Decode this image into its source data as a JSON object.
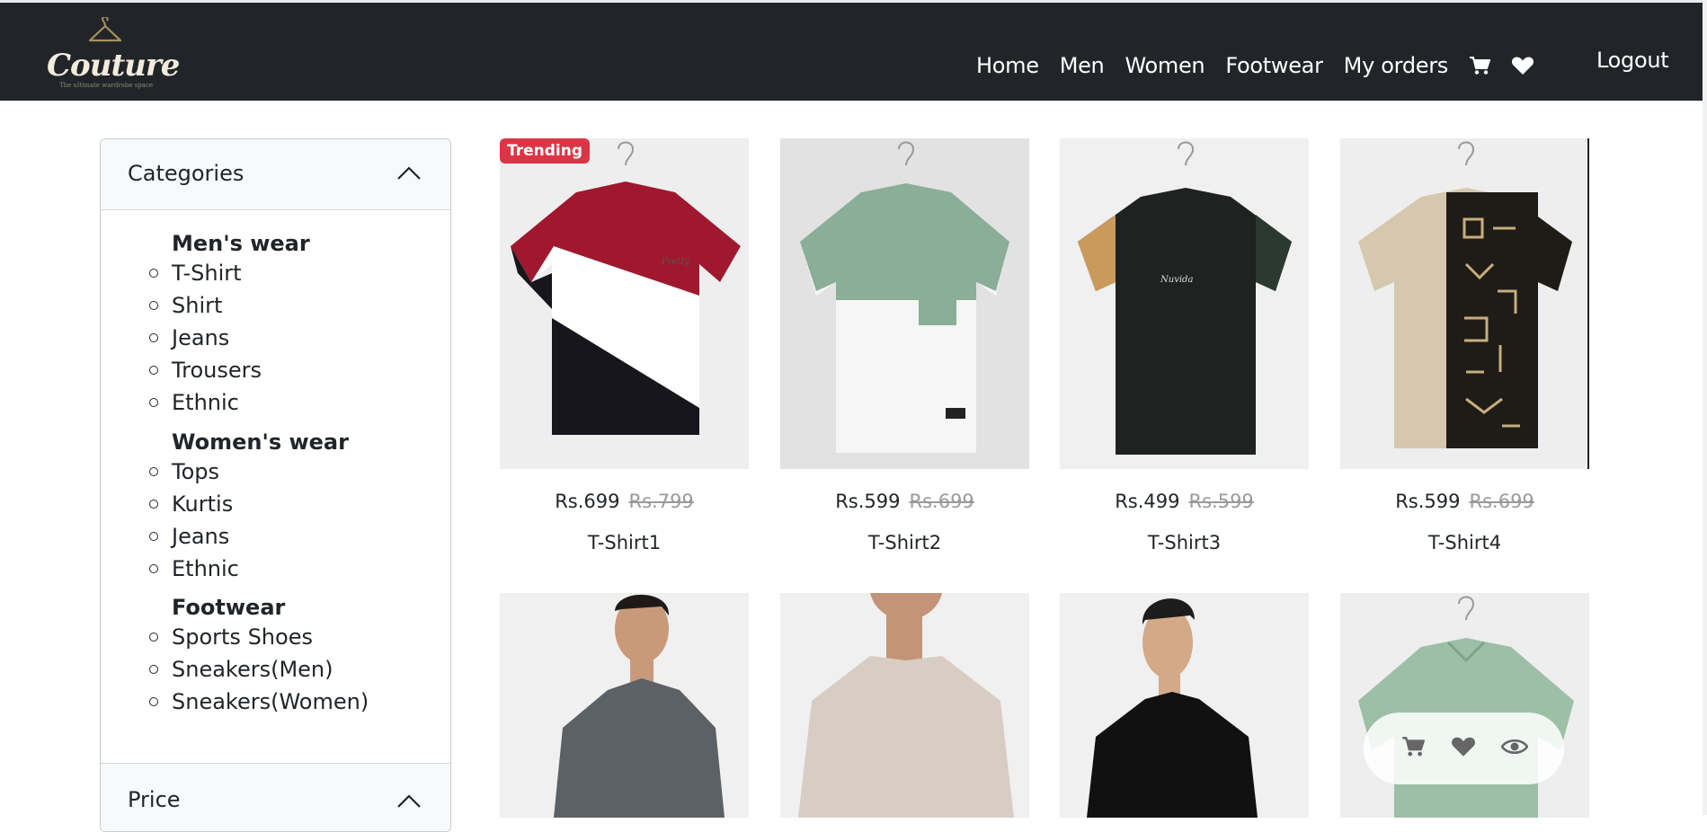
{
  "brand": {
    "name": "Couture",
    "tagline": "The ultimate wardrobe space",
    "logo_icon": "hanger-icon"
  },
  "nav": {
    "links": [
      "Home",
      "Men",
      "Women",
      "Footwear",
      "My orders"
    ],
    "cart_icon": "cart-icon",
    "wishlist_icon": "heart-icon",
    "logout": "Logout"
  },
  "sidebar": {
    "categories_title": "Categories",
    "groups": [
      {
        "title": "Men's wear",
        "items": [
          "T-Shirt",
          "Shirt",
          "Jeans",
          "Trousers",
          "Ethnic"
        ]
      },
      {
        "title": "Women's wear",
        "items": [
          "Tops",
          "Kurtis",
          "Jeans",
          "Ethnic"
        ]
      },
      {
        "title": "Footwear",
        "items": [
          "Sports Shoes",
          "Sneakers(Men)",
          "Sneakers(Women)"
        ]
      }
    ],
    "price_title": "Price"
  },
  "products": [
    {
      "name": "T-Shirt1",
      "price": "Rs.699",
      "old_price": "Rs.799",
      "badge": "Trending"
    },
    {
      "name": "T-Shirt2",
      "price": "Rs.599",
      "old_price": "Rs.699"
    },
    {
      "name": "T-Shirt3",
      "price": "Rs.499",
      "old_price": "Rs.599"
    },
    {
      "name": "T-Shirt4",
      "price": "Rs.599",
      "old_price": "Rs.699"
    }
  ],
  "hover_actions": [
    "cart-icon",
    "heart-icon",
    "eye-icon"
  ],
  "colors": {
    "navbar": "#212529",
    "badge": "#dc3545",
    "sidebar_header": "#f8f9fa"
  }
}
